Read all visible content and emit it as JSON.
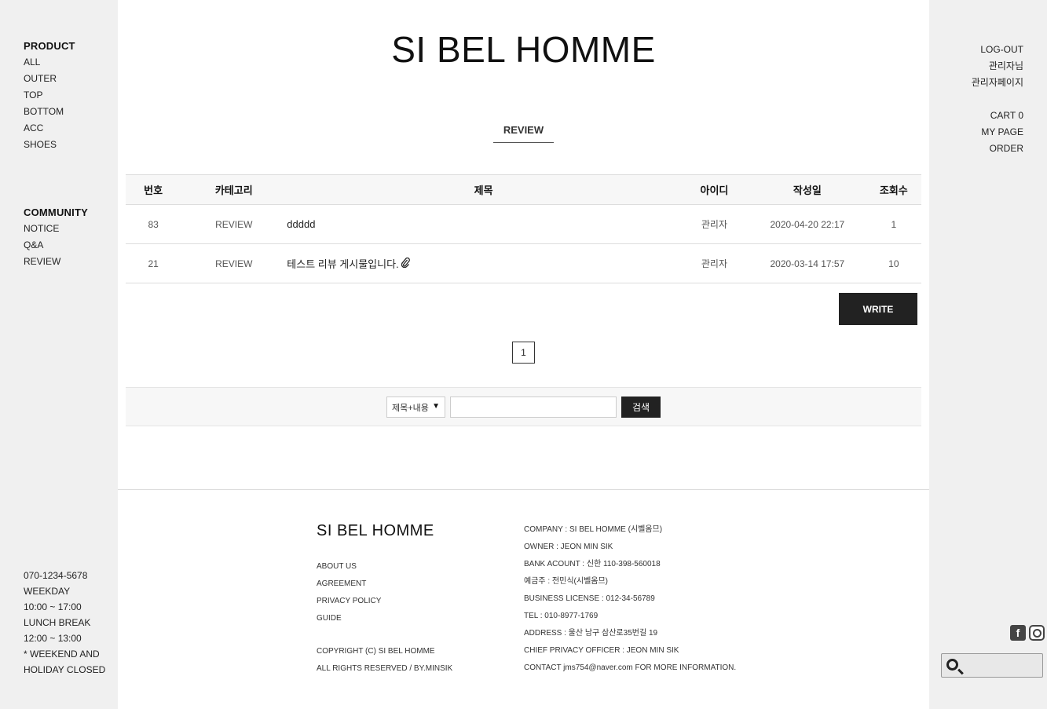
{
  "left_nav": {
    "product_heading": "PRODUCT",
    "product_items": [
      "ALL",
      "OUTER",
      "TOP",
      "BOTTOM",
      "ACC",
      "SHOES"
    ],
    "community_heading": "COMMUNITY",
    "community_items": [
      "NOTICE",
      "Q&A",
      "REVIEW"
    ],
    "contact_info": [
      "070-1234-5678",
      "WEEKDAY",
      "10:00 ~ 17:00",
      "LUNCH BREAK",
      "12:00 ~ 13:00",
      "* WEEKEND AND",
      "HOLIDAY CLOSED"
    ]
  },
  "right_nav": {
    "account_items": [
      "LOG-OUT",
      "관리자님",
      "관리자페이지"
    ],
    "shop_items": [
      "CART 0",
      "MY PAGE",
      "ORDER"
    ],
    "social_icons": [
      "facebook-icon",
      "instagram-icon"
    ],
    "search_icon": "search-icon"
  },
  "header": {
    "logo": "SI BEL HOMME"
  },
  "board": {
    "title": "REVIEW",
    "columns": [
      "번호",
      "카테고리",
      "제목",
      "아이디",
      "작성일",
      "조회수"
    ],
    "rows": [
      {
        "no": "83",
        "category": "REVIEW",
        "subject": "ddddd",
        "author": "관리자",
        "date": "2020-04-20 22:17",
        "views": "1",
        "attachment": false
      },
      {
        "no": "21",
        "category": "REVIEW",
        "subject": "테스트 리뷰 게시물입니다.",
        "author": "관리자",
        "date": "2020-03-14 17:57",
        "views": "10",
        "attachment": true
      }
    ],
    "write_label": "WRITE",
    "current_page": "1"
  },
  "search": {
    "select_value": "제목+내용",
    "input_value": "",
    "button_label": "검색"
  },
  "footer": {
    "logo": "SI BEL HOMME",
    "links": [
      "ABOUT US",
      "AGREEMENT",
      "PRIVACY POLICY",
      "GUIDE"
    ],
    "copyright": [
      "COPYRIGHT (C) SI BEL HOMME",
      "ALL RIGHTS RESERVED / BY.MINSIK"
    ],
    "company_info": [
      "COMPANY : SI BEL HOMME (시벨옴므)",
      "OWNER : JEON MIN SIK",
      "BANK ACOUNT : 신한 110-398-560018",
      "예금주 : 전민식(시벨옴므)",
      "BUSINESS LICENSE : 012-34-56789",
      "TEL : 010-8977-1769",
      "ADDRESS : 울산 남구 삼산로35번길 19",
      "CHIEF PRIVACY OFFICER : JEON MIN SIK",
      "CONTACT jms754@naver.com FOR MORE INFORMATION."
    ]
  },
  "colors": {
    "sidebar_bg": "#f0f0f0",
    "main_bg": "#ffffff",
    "button_dark": "#222222"
  }
}
